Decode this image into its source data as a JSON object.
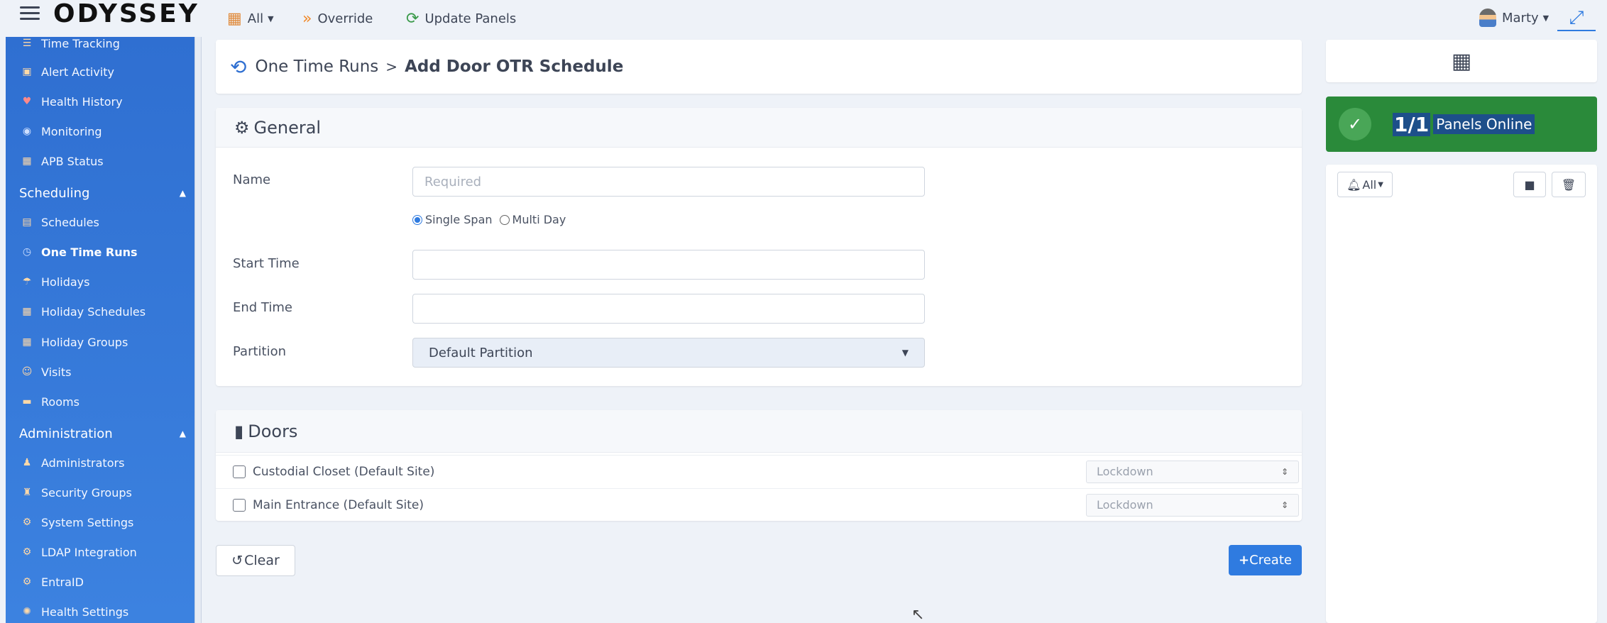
{
  "app": {
    "logo": "ODYSSEY"
  },
  "topnav": {
    "all_label": "All",
    "override_label": "Override",
    "update_label": "Update Panels",
    "user_name": "Marty"
  },
  "sidebar": {
    "items_top": [
      {
        "label": "Time Tracking",
        "icon": "list-icon"
      },
      {
        "label": "Alert Activity",
        "icon": "alert-icon"
      },
      {
        "label": "Health History",
        "icon": "heart-icon"
      },
      {
        "label": "Monitoring",
        "icon": "monitor-icon"
      },
      {
        "label": "APB Status",
        "icon": "calendar-icon"
      }
    ],
    "scheduling_title": "Scheduling",
    "scheduling_items": [
      {
        "label": "Schedules",
        "icon": "schedule-icon"
      },
      {
        "label": "One Time Runs",
        "icon": "clock-icon"
      },
      {
        "label": "Holidays",
        "icon": "umbrella-icon"
      },
      {
        "label": "Holiday Schedules",
        "icon": "calendar-icon"
      },
      {
        "label": "Holiday Groups",
        "icon": "calendar-group-icon"
      },
      {
        "label": "Visits",
        "icon": "person-walk-icon"
      },
      {
        "label": "Rooms",
        "icon": "room-icon"
      }
    ],
    "administration_title": "Administration",
    "administration_items": [
      {
        "label": "Administrators",
        "icon": "admin-icon"
      },
      {
        "label": "Security Groups",
        "icon": "group-icon"
      },
      {
        "label": "System Settings",
        "icon": "gear-icon"
      },
      {
        "label": "LDAP Integration",
        "icon": "gear-icon"
      },
      {
        "label": "EntraID",
        "icon": "gear-icon"
      },
      {
        "label": "Health Settings",
        "icon": "health-gear-icon"
      }
    ]
  },
  "breadcrumb": {
    "parent": "One Time Runs",
    "separator": ">",
    "current": "Add Door OTR Schedule"
  },
  "general": {
    "title": "General",
    "name_label": "Name",
    "name_placeholder": "Required",
    "name_value": "",
    "span_single": "Single Span",
    "span_multi": "Multi Day",
    "span_selected": "Single Span",
    "start_label": "Start Time",
    "start_value": "",
    "end_label": "End Time",
    "end_value": "",
    "partition_label": "Partition",
    "partition_value": "Default Partition"
  },
  "doors": {
    "title": "Doors",
    "rows": [
      {
        "label": "Custodial Closet (Default Site)",
        "mode": "Lockdown",
        "checked": false
      },
      {
        "label": "Main Entrance (Default Site)",
        "mode": "Lockdown",
        "checked": false
      }
    ]
  },
  "actions": {
    "clear_label": "Clear",
    "create_label": "Create"
  },
  "panels": {
    "online_count": "1/1",
    "online_label": "Panels Online",
    "filter_label": "All",
    "status_color": "#2a8a3a"
  }
}
